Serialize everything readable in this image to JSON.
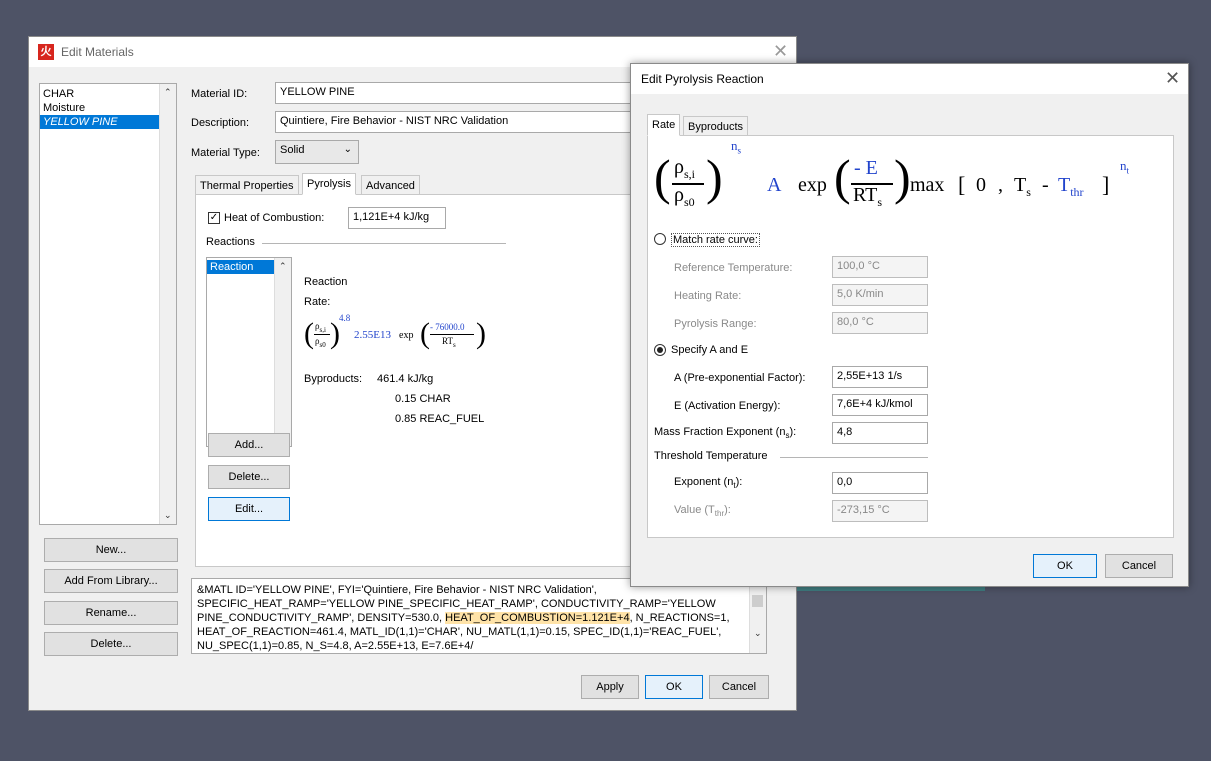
{
  "edit_materials": {
    "title": "Edit Materials",
    "materials": [
      "CHAR",
      "Moisture",
      "YELLOW PINE"
    ],
    "material_id_label": "Material ID:",
    "material_id": "YELLOW PINE",
    "description_label": "Description:",
    "description": "Quintiere, Fire Behavior - NIST NRC Validation",
    "material_type_label": "Material Type:",
    "material_type": "Solid",
    "tabs": [
      "Thermal Properties",
      "Pyrolysis",
      "Advanced"
    ],
    "heat_of_combustion_label": "Heat of Combustion:",
    "heat_of_combustion": "1,121E+4 kJ/kg",
    "reactions_label": "Reactions",
    "reactions": [
      "Reaction"
    ],
    "reaction_title": "Reaction",
    "rate_label": "Rate:",
    "rate_exponent": "4.8",
    "rate_A": "2.55E13",
    "rate_exp": "exp",
    "rate_num": "- 76000.0",
    "rate_den": "RT",
    "byproducts_label": "Byproducts:",
    "byproducts": [
      "461.4 kJ/kg",
      "0.15 CHAR",
      "0.85 REAC_FUEL"
    ],
    "reaction_buttons": [
      "Add...",
      "Delete...",
      "Edit..."
    ],
    "side_buttons": [
      "New...",
      "Add From Library...",
      "Rename...",
      "Delete..."
    ],
    "fds_text_pre": "&MATL ID='YELLOW PINE', FYI='Quintiere, Fire Behavior - NIST NRC Validation', SPECIFIC_HEAT_RAMP='YELLOW PINE_SPECIFIC_HEAT_RAMP', CONDUCTIVITY_RAMP='YELLOW PINE_CONDUCTIVITY_RAMP', DENSITY=530.0, ",
    "fds_text_highlight": "HEAT_OF_COMBUSTION=1.121E+4",
    "fds_text_post": ", N_REACTIONS=1, HEAT_OF_REACTION=461.4, MATL_ID(1,1)='CHAR', NU_MATL(1,1)=0.15, SPEC_ID(1,1)='REAC_FUEL', NU_SPEC(1,1)=0.85, N_S=4.8, A=2.55E+13, E=7.6E+4/",
    "bottom_buttons": [
      "Apply",
      "OK",
      "Cancel"
    ]
  },
  "pyrolysis_dialog": {
    "title": "Edit Pyrolysis Reaction",
    "tabs": [
      "Rate",
      "Byproducts"
    ],
    "formula": {
      "rho_num": "ρ",
      "rho_num_sub": "s,i",
      "rho_den": "ρ",
      "rho_den_sub": "s0",
      "exp_ns": "n",
      "exp_ns_sub": "s",
      "A": "A",
      "exp": "exp",
      "neg_E": "- E",
      "RT": "RT",
      "RT_sub": "s",
      "max": "max",
      "bracket_open": "[",
      "zero": "0",
      "comma": ",",
      "Ts": "T",
      "Ts_sub": "s",
      "minus": "-",
      "Tthr": "T",
      "Tthr_sub": "thr",
      "bracket_close": "]",
      "exp_nt": "n",
      "exp_nt_sub": "t"
    },
    "match_rate_label": "Match rate curve:",
    "ref_temp_label": "Reference Temperature:",
    "ref_temp": "100,0 °C",
    "heating_rate_label": "Heating Rate:",
    "heating_rate": "5,0 K/min",
    "pyro_range_label": "Pyrolysis Range:",
    "pyro_range": "80,0 °C",
    "specify_label": "Specify A and E",
    "A_label": "A (Pre-exponential Factor):",
    "A_value": "2,55E+13 1/s",
    "E_label": "E (Activation Energy):",
    "E_value": "7,6E+4 kJ/kmol",
    "mfe_label_pre": "Mass Fraction Exponent (n",
    "mfe_label_sub": "s",
    "mfe_label_post": "):",
    "mfe_value": "4,8",
    "threshold_label": "Threshold Temperature",
    "exponent_label_pre": "Exponent (n",
    "exponent_label_sub": "t",
    "exponent_label_post": "):",
    "exponent_value": "0,0",
    "value_label_pre": "Value (T",
    "value_label_sub": "thr",
    "value_label_post": "):",
    "value_value": "-273,15 °C",
    "ok": "OK",
    "cancel": "Cancel"
  }
}
